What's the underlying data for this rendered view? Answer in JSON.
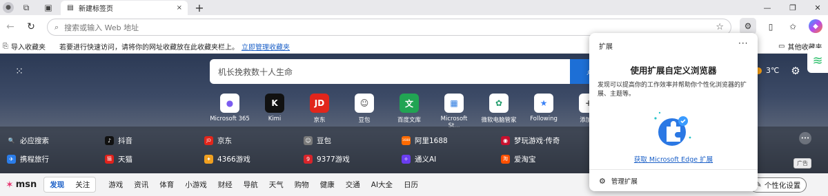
{
  "tab": {
    "title": "新建标签页",
    "close": "×",
    "new_tab": "+"
  },
  "address": {
    "placeholder": "搜索或输入 Web 地址"
  },
  "window": {
    "minimize": "—",
    "restore": "❐",
    "close": "✕"
  },
  "favorites": {
    "import_label": "导入收藏夹",
    "hint": "若要进行快速访问，请将你的网址收藏放在此收藏夹栏上。",
    "manage_link": "立即管理收藏夹",
    "other_label": "其他收藏夹"
  },
  "search": {
    "placeholder": "机长挽救数十人生命"
  },
  "weather": {
    "temp": "3℃"
  },
  "sites": [
    {
      "label": "Microsoft 365",
      "glyph": "●",
      "color": "#7b5cf0"
    },
    {
      "label": "Kimi",
      "glyph": "K",
      "color": "#111111"
    },
    {
      "label": "京东",
      "glyph": "JD",
      "color": "#e1251b"
    },
    {
      "label": "豆包",
      "glyph": "☺",
      "color": "#444444"
    },
    {
      "label": "百度文库",
      "glyph": "文",
      "color": "#21a453"
    },
    {
      "label": "Microsoft St...",
      "glyph": "▦",
      "color": "#2f7de1"
    },
    {
      "label": "微软电脑管家",
      "glyph": "✿",
      "color": "#1f9c6a"
    },
    {
      "label": "Following",
      "glyph": "★",
      "color": "#3b82f6"
    },
    {
      "label": "添加网",
      "glyph": "+",
      "color": "#555555"
    }
  ],
  "quick_links": {
    "row1": [
      {
        "label": "必应搜索",
        "glyph": "🔍",
        "color": "#1f6fd1"
      },
      {
        "label": "抖音",
        "glyph": "♪",
        "color": "#111111"
      },
      {
        "label": "京东",
        "glyph": "JD",
        "color": "#e1251b"
      },
      {
        "label": "豆包",
        "glyph": "☺",
        "color": "#7a7a7a"
      },
      {
        "label": "阿里1688",
        "glyph": "1688",
        "color": "#ff6a00"
      },
      {
        "label": "梦玩游戏·传奇",
        "glyph": "◉",
        "color": "#c8102e"
      }
    ],
    "row2": [
      {
        "label": "携程旅行",
        "glyph": "✈",
        "color": "#2b7de9"
      },
      {
        "label": "天猫",
        "glyph": "猫",
        "color": "#e0211b"
      },
      {
        "label": "4366游戏",
        "glyph": "✦",
        "color": "#f0a020"
      },
      {
        "label": "9377游戏",
        "glyph": "9",
        "color": "#d8242a"
      },
      {
        "label": "通义AI",
        "glyph": "✧",
        "color": "#6a3df0"
      },
      {
        "label": "爱淘宝",
        "glyph": "淘",
        "color": "#ff5000"
      }
    ],
    "ad_label": "广告",
    "more": "•••"
  },
  "msn": {
    "logo": "msn",
    "tabs": [
      "发现",
      "关注"
    ],
    "nav": [
      "游戏",
      "资讯",
      "体育",
      "小游戏",
      "财经",
      "导航",
      "天气",
      "购物",
      "健康",
      "交通",
      "AI大全",
      "日历"
    ],
    "personalize": "个性化设置"
  },
  "extensions_panel": {
    "title": "扩展",
    "more": "···",
    "heading": "使用扩展自定义浏览器",
    "description": "发现可以提高你的工作效率并帮助你个性化浏览器的扩展、主题等。",
    "get_link": "获取 Microsoft Edge 扩展",
    "manage": "管理扩展"
  }
}
